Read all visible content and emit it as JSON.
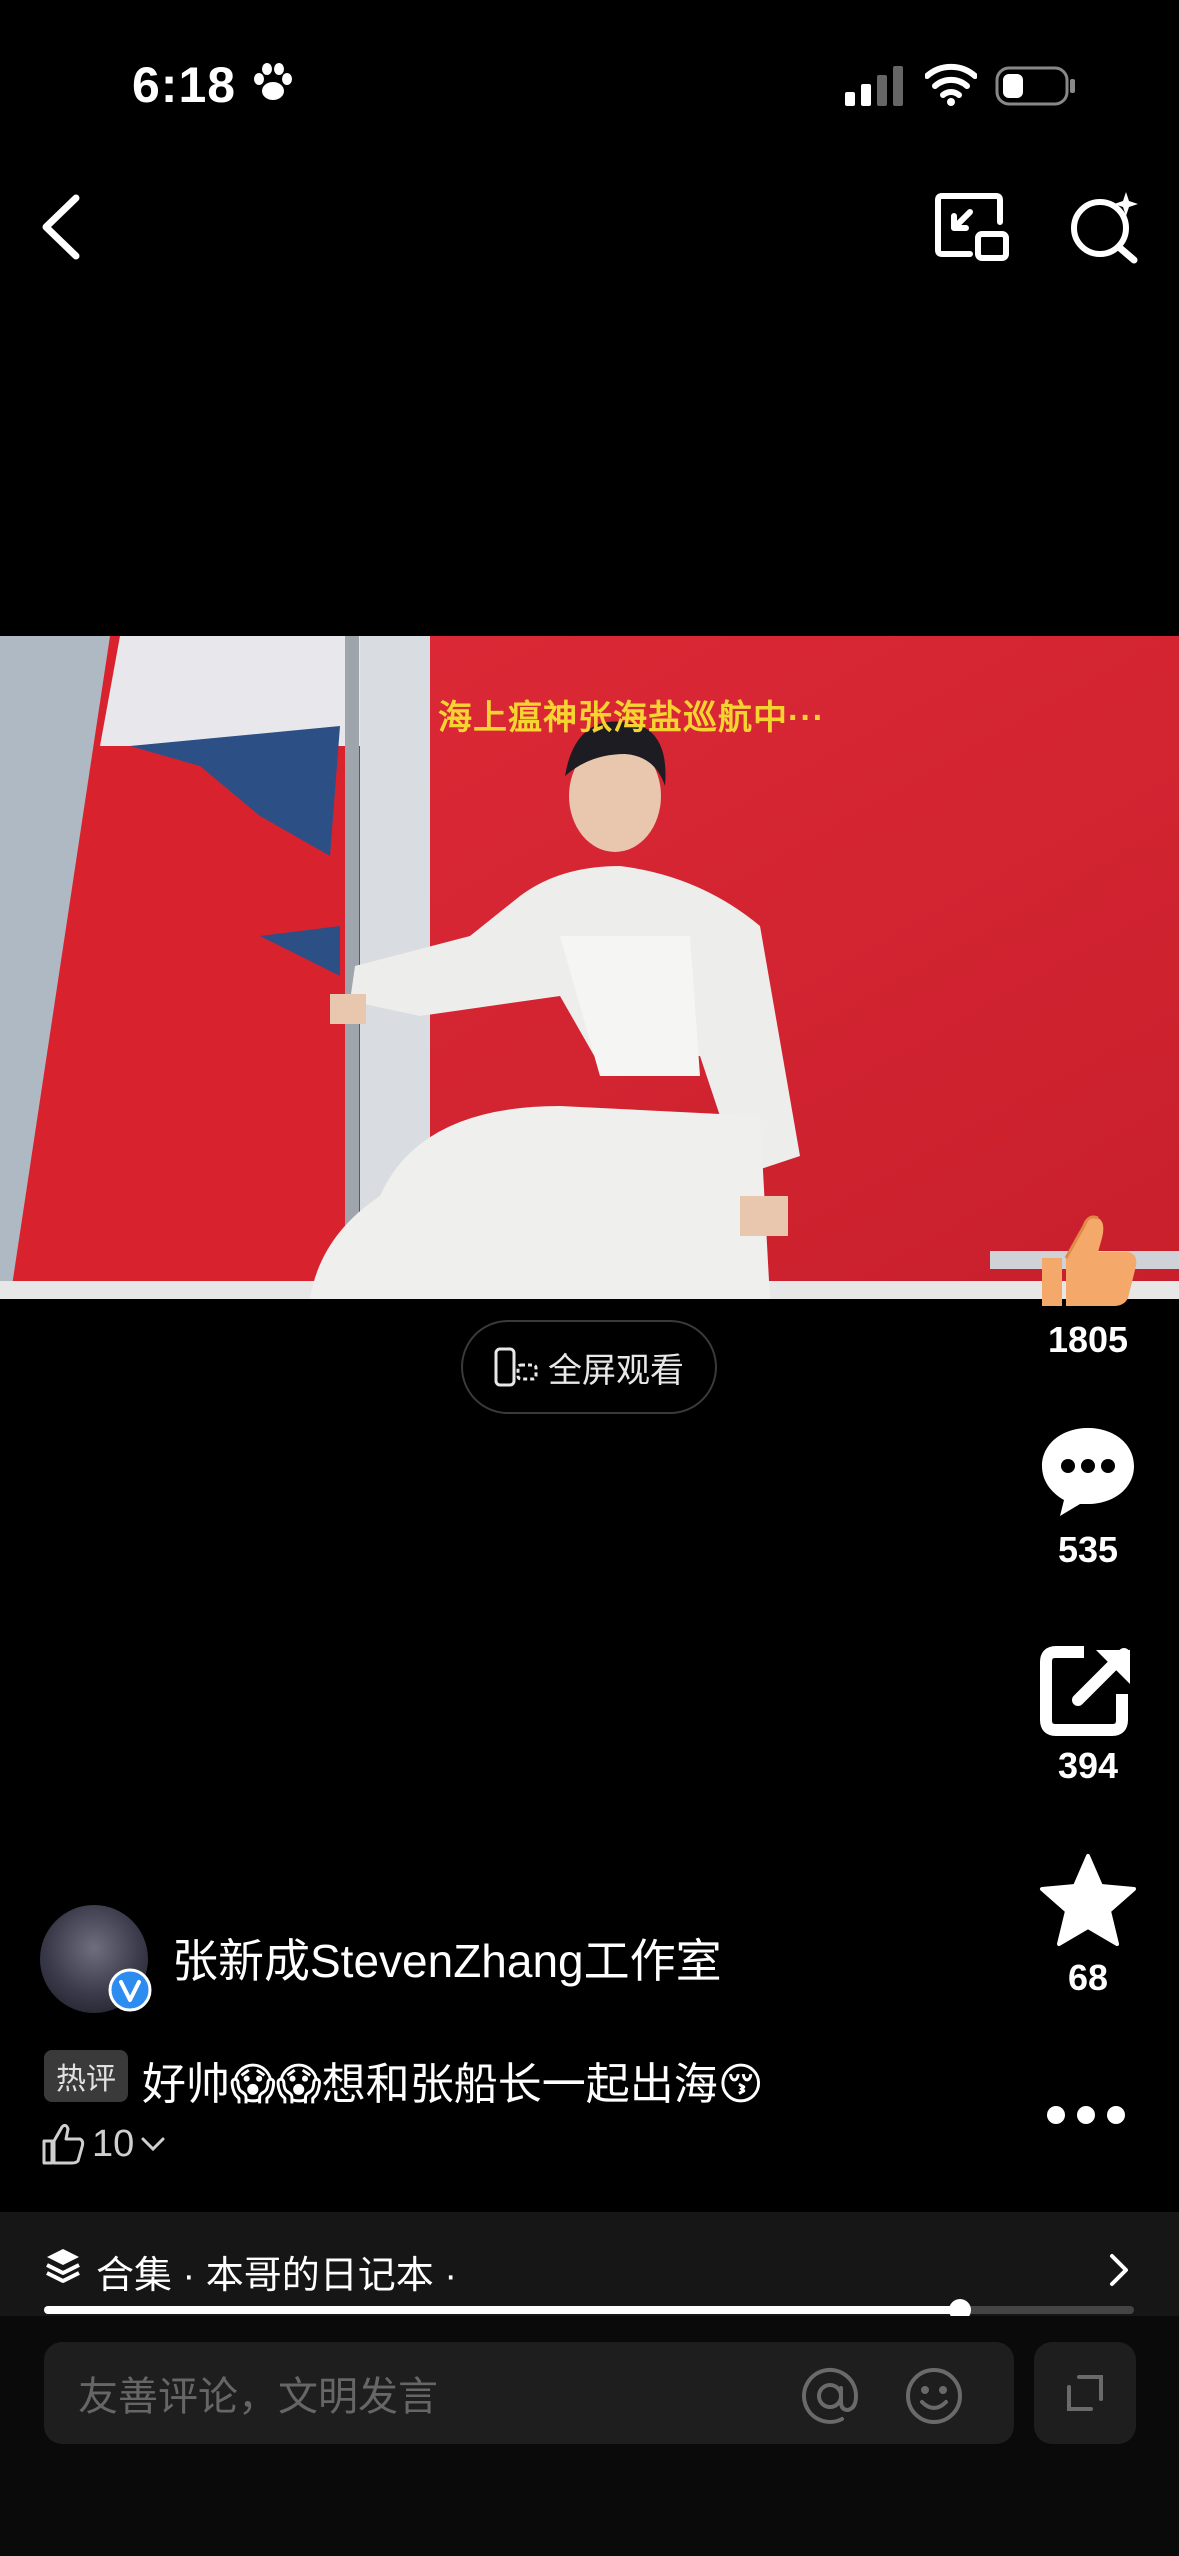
{
  "status_bar": {
    "time": "6:18"
  },
  "video": {
    "caption": "海上瘟神张海盐巡航中···",
    "fullscreen_label": "全屏观看"
  },
  "actions": {
    "like_count": "1805",
    "comment_count": "535",
    "share_count": "394",
    "favorite_count": "68"
  },
  "author": {
    "name": "张新成StevenZhang工作室"
  },
  "hot_comment": {
    "badge": "热评",
    "text_1": "好帅",
    "text_2": "想和张船长一起出海",
    "like_count": "10"
  },
  "collection": {
    "label": "合集 · 本哥的日记本 · ",
    "progress": 0.84
  },
  "comment_input": {
    "placeholder": "友善评论，文明发言"
  },
  "colors": {
    "background": "#000000",
    "caption": "#f5d432",
    "like_thumb": "#f4a86a",
    "verified": "#2d8cf0"
  }
}
